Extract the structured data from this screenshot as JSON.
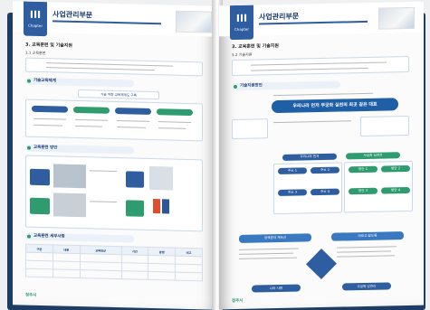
{
  "left_page": {
    "tab_number": "III",
    "tab_label": "Chapter",
    "page_title": "사업관리부문",
    "section_heading": "3. 교육훈련 및 기술지원",
    "subsection_heading": "3.1 교육훈련",
    "section_bar_1": "기술교육체계",
    "center_label": "기술 역량 교육체계도 구축",
    "section_bar_2": "교육훈련 방안",
    "section_bar_3": "교육훈련 세부사항",
    "table_headers": [
      "구분",
      "내용",
      "교육대상",
      "기간",
      "방법",
      "비고"
    ],
    "footer_logo": "청주시"
  },
  "right_page": {
    "tab_number": "III",
    "tab_label": "Chapter",
    "page_title": "사업관리부문",
    "section_heading": "3. 교육훈련 및 기술지원",
    "subsection_heading": "3.2 기술지원",
    "section_bar_1": "기술지원방안",
    "banner_main": "우리나라 먼저 무궁화 실천의 최곳 같은 대표",
    "label_left": "우리나라 먼저",
    "label_right": "무궁화 실천의",
    "group_labels": [
      "주요 1",
      "주요 2",
      "주요 3",
      "주요 4",
      "방안 1",
      "방안 2",
      "방안 3",
      "방안 4"
    ],
    "bottom_pill_left": "정책분야 계속선",
    "bottom_pill_right": "마르고 닳도록",
    "bottom_btn_left": "나라 사랑",
    "bottom_btn_right": "무궁화 삼천리",
    "footer_logo": "청주시"
  },
  "colors": {
    "primary": "#2e5da0",
    "accent": "#2e9c6e",
    "cover": "#1e3d63"
  }
}
